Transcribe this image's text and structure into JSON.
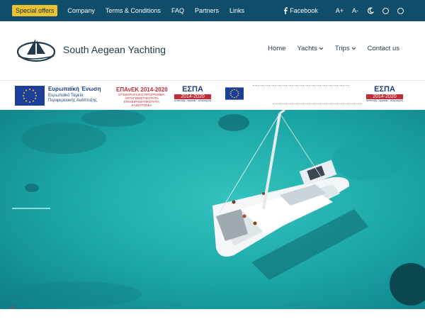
{
  "topbar": {
    "special_offers": "Special offers",
    "links": [
      "Company",
      "Terms & Conditions",
      "FAQ",
      "Partners",
      "Links"
    ],
    "facebook": "Facebook",
    "font_increase": "A+",
    "font_decrease": "A-"
  },
  "header": {
    "brand": "South Aegean Yachting",
    "nav": [
      "Home",
      "Yachts",
      "Trips",
      "Contact us"
    ]
  },
  "banner": {
    "eu_title": "Ευρωπαϊκή Ένωση",
    "eu_sub_1": "Ευρωπαϊκό Ταμείο",
    "eu_sub_2": "Περιφερειακής Ανάπτυξης",
    "epanek_title": "ΕΠΑνΕΚ 2014-2020",
    "epanek_sub_1": "ΕΠΙΧΕΙΡΗΣΙΑΚΟ ΠΡΟΓΡΑΜΜΑ",
    "epanek_sub_2": "ΑΝΤΑΓΩΝΙΣΤΙΚΟΤΗΤΑ",
    "epanek_sub_3": "ΕΠΙΧΕΙΡΗΜΑΤΙΚΟΤΗΤΑ",
    "epanek_sub_4": "ΚΑΙΝΟΤΟΜΙΑ",
    "espa_title": "ΕΣΠΑ",
    "espa_years": "2014-2020",
    "espa_motto": "ανάπτυξη - εργασία - αλληλεγγύη"
  },
  "colors": {
    "topbar": "#0f4d6b",
    "special_offer_bg": "#e9c233",
    "sea": "#19a7a4",
    "text": "#233a4a"
  },
  "icons": [
    "facebook-icon",
    "moon-icon",
    "ring-icon",
    "chevron-down-icon"
  ]
}
